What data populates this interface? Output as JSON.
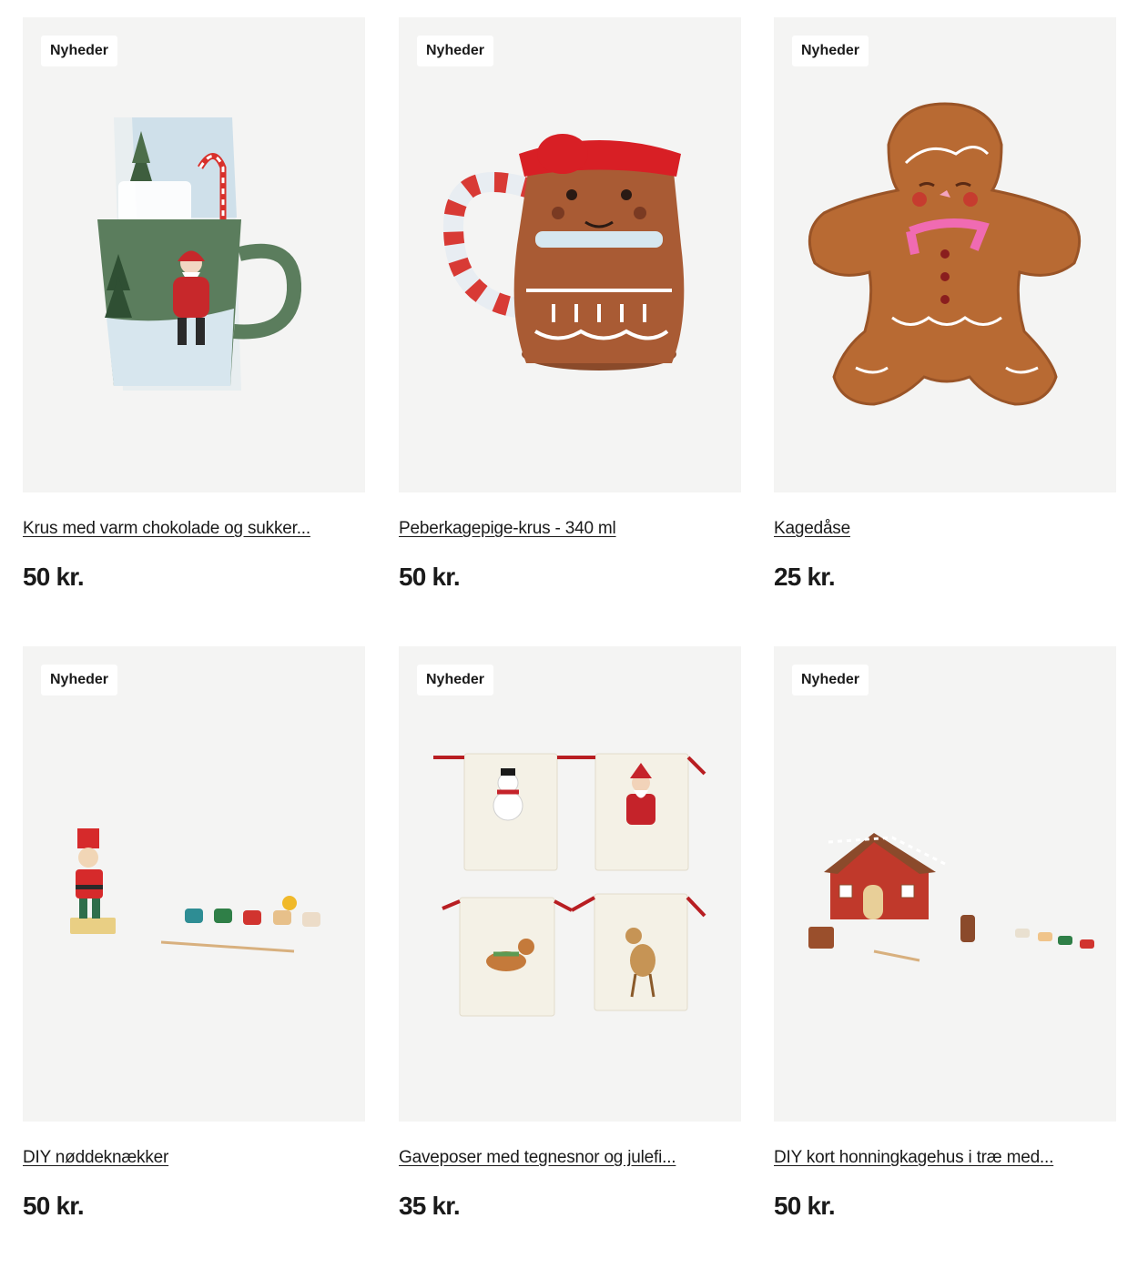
{
  "products": [
    {
      "badge": "Nyheder",
      "title": "Krus med varm chokolade og sukker...",
      "price": "50 kr.",
      "image": "santa-mug-with-hot-chocolate-image"
    },
    {
      "badge": "Nyheder",
      "title": "Peberkagepige-krus - 340 ml",
      "price": "50 kr.",
      "image": "gingerbread-girl-mug-image"
    },
    {
      "badge": "Nyheder",
      "title": "Kagedåse",
      "price": "25 kr.",
      "image": "gingerbread-cookie-tin-image"
    },
    {
      "badge": "Nyheder",
      "title": "DIY nøddeknækker",
      "price": "50 kr.",
      "image": "diy-nutcracker-kit-image"
    },
    {
      "badge": "Nyheder",
      "title": "Gaveposer med tegnesnor og julefi...",
      "price": "35 kr.",
      "image": "christmas-gift-bags-image"
    },
    {
      "badge": "Nyheder",
      "title": "DIY kort honningkagehus i træ med...",
      "price": "50 kr.",
      "image": "diy-gingerbread-house-kit-image"
    }
  ],
  "colors": {
    "card_background": "#f4f4f3",
    "badge_background": "#ffffff",
    "text": "#1a1a1a"
  }
}
